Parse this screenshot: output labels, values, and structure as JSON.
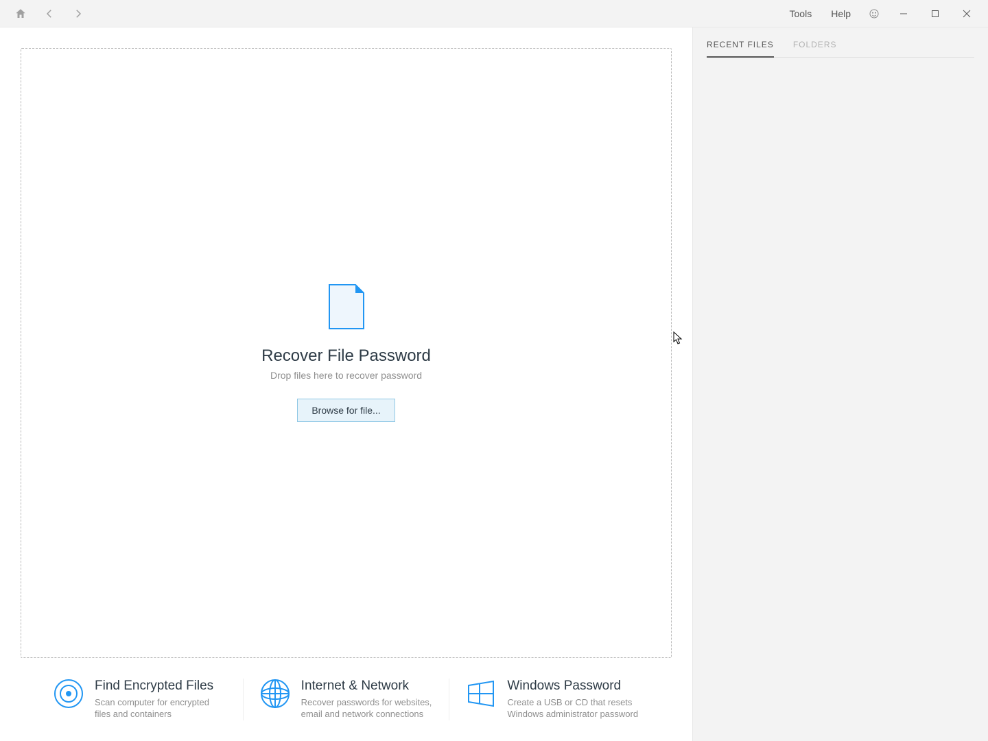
{
  "menu": {
    "tools": "Tools",
    "help": "Help"
  },
  "dropzone": {
    "title": "Recover File Password",
    "subtitle": "Drop files here to recover password",
    "button": "Browse for file..."
  },
  "cards": {
    "encrypted": {
      "title": "Find Encrypted Files",
      "desc": "Scan computer for encrypted files and containers"
    },
    "internet": {
      "title": "Internet & Network",
      "desc": "Recover passwords for websites, email and network connections"
    },
    "windows": {
      "title": "Windows Password",
      "desc": "Create a USB or CD that resets Windows administrator password"
    }
  },
  "sidebar": {
    "tabs": {
      "recent": "RECENT FILES",
      "folders": "FOLDERS"
    }
  }
}
